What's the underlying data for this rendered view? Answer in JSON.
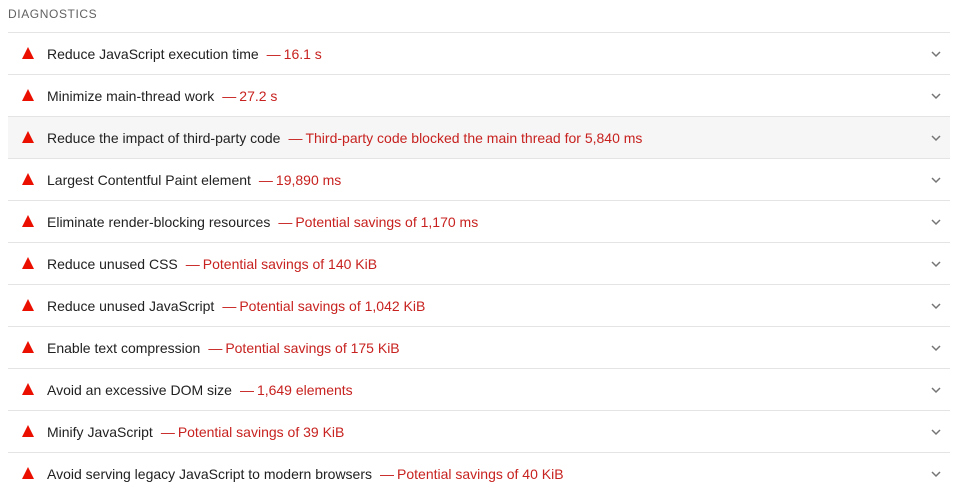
{
  "section": {
    "title": "DIAGNOSTICS"
  },
  "colors": {
    "fail": "#eb0f00",
    "value_text": "#c7221f",
    "title_text": "#212121"
  },
  "audits": [
    {
      "title": "Reduce JavaScript execution time",
      "separator": "—",
      "value": "16.1 s",
      "status": "fail",
      "icon": "fail-triangle-icon",
      "expanded": false
    },
    {
      "title": "Minimize main-thread work",
      "separator": "—",
      "value": "27.2 s",
      "status": "fail",
      "icon": "fail-triangle-icon",
      "expanded": false
    },
    {
      "title": "Reduce the impact of third-party code",
      "separator": "—",
      "value": "Third-party code blocked the main thread for 5,840 ms",
      "status": "fail",
      "icon": "fail-triangle-icon",
      "expanded": false
    },
    {
      "title": "Largest Contentful Paint element",
      "separator": "—",
      "value": "19,890 ms",
      "status": "fail",
      "icon": "fail-triangle-icon",
      "expanded": false
    },
    {
      "title": "Eliminate render-blocking resources",
      "separator": "—",
      "value": "Potential savings of 1,170 ms",
      "status": "fail",
      "icon": "fail-triangle-icon",
      "expanded": false
    },
    {
      "title": "Reduce unused CSS",
      "separator": "—",
      "value": "Potential savings of 140 KiB",
      "status": "fail",
      "icon": "fail-triangle-icon",
      "expanded": false
    },
    {
      "title": "Reduce unused JavaScript",
      "separator": "—",
      "value": "Potential savings of 1,042 KiB",
      "status": "fail",
      "icon": "fail-triangle-icon",
      "expanded": false
    },
    {
      "title": "Enable text compression",
      "separator": "—",
      "value": "Potential savings of 175 KiB",
      "status": "fail",
      "icon": "fail-triangle-icon",
      "expanded": false
    },
    {
      "title": "Avoid an excessive DOM size",
      "separator": "—",
      "value": "1,649 elements",
      "status": "fail",
      "icon": "fail-triangle-icon",
      "expanded": false
    },
    {
      "title": "Minify JavaScript",
      "separator": "—",
      "value": "Potential savings of 39 KiB",
      "status": "fail",
      "icon": "fail-triangle-icon",
      "expanded": false
    },
    {
      "title": "Avoid serving legacy JavaScript to modern browsers",
      "separator": "—",
      "value": "Potential savings of 40 KiB",
      "status": "fail",
      "icon": "fail-triangle-icon",
      "expanded": false
    }
  ]
}
